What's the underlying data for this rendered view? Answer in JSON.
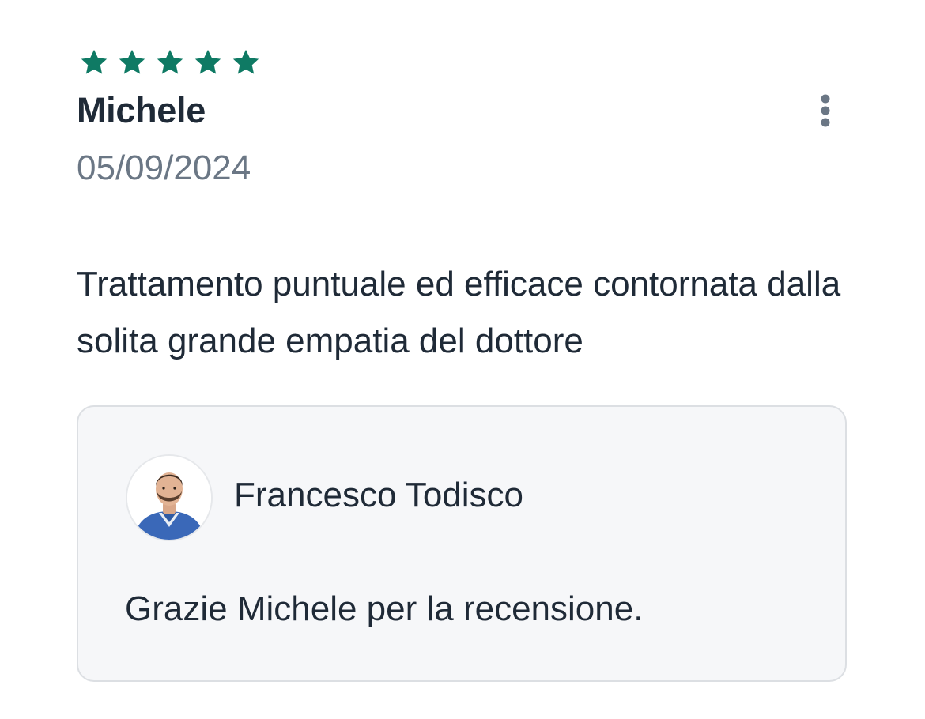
{
  "review": {
    "rating": 5,
    "rating_max": 5,
    "star_color": "#0f7a64",
    "reviewer_name": "Michele",
    "date": "05/09/2024",
    "text": "Trattamento puntuale ed efficace contornata dalla solita grande empatia del dottore",
    "more_icon": "more-vertical-icon"
  },
  "reply": {
    "author": "Francesco Todisco",
    "text": "Grazie Michele per la recensione."
  }
}
